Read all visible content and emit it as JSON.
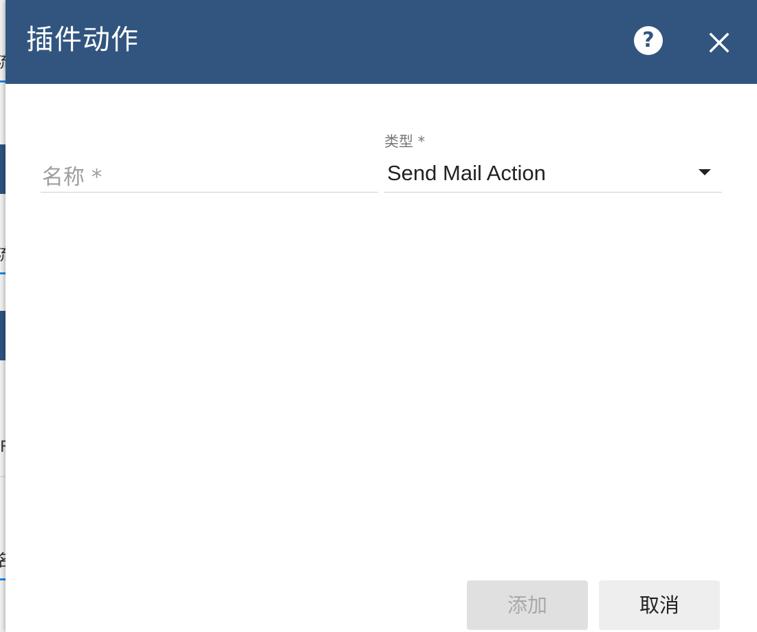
{
  "background": {
    "chars": [
      "流",
      "流",
      "F",
      "名"
    ]
  },
  "dialog": {
    "title": "插件动作",
    "help_icon": "help-circle-icon",
    "close_icon": "close-icon",
    "help_symbol": "?",
    "colors": {
      "header": "#31557f",
      "primary_text": "#222222",
      "disabled_text": "#a8a8a8"
    }
  },
  "form": {
    "name_field": {
      "label": "名称 *",
      "value": ""
    },
    "type_field": {
      "label": "类型 *",
      "value": "Send Mail Action",
      "arrow_icon": "dropdown-arrow-icon"
    }
  },
  "actions": {
    "add_label": "添加",
    "add_disabled": true,
    "cancel_label": "取消"
  }
}
